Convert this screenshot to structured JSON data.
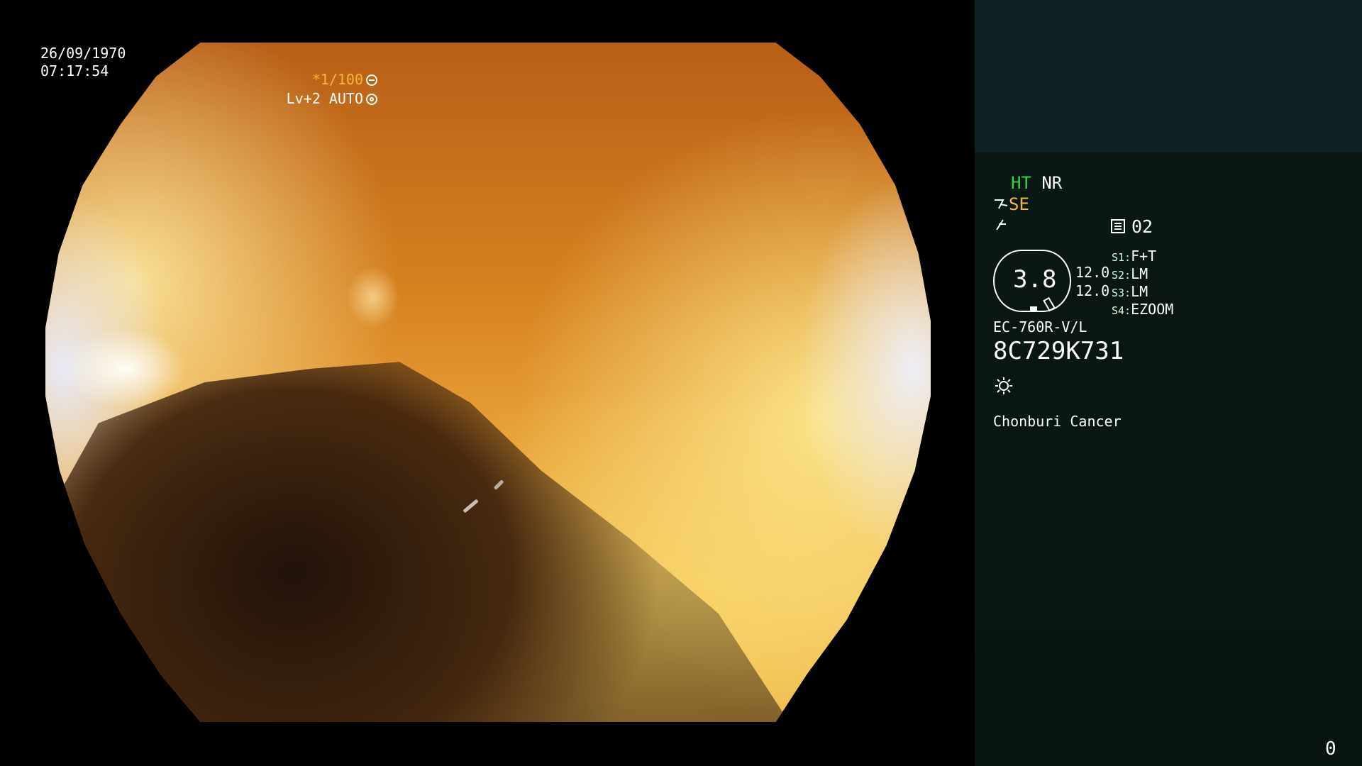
{
  "view": {
    "date": "26/09/1970",
    "time": "07:17:54",
    "shutter": "*1/100",
    "level": "Lv+2 AUTO"
  },
  "panel": {
    "ht_label": "HT",
    "nr_label": "NR",
    "se_label": "SE",
    "page_number": "02",
    "magnification": "3.8",
    "val1": "12.0",
    "val2": "12.0",
    "switches": [
      {
        "prefix": "S1:",
        "value": "F+T"
      },
      {
        "prefix": "S2:",
        "value": "LM"
      },
      {
        "prefix": "S3:",
        "value": "LM"
      },
      {
        "prefix": "S4:",
        "value": "EZOOM"
      }
    ],
    "scope_model": "EC-760R-V/L",
    "serial": "8C729K731",
    "hospital": "Chonburi Cancer",
    "counter": "0"
  },
  "icons": [
    "shutter-icon",
    "auto-level-icon",
    "structure-icon",
    "color-tone-icon",
    "doc-icon",
    "light-icon"
  ]
}
